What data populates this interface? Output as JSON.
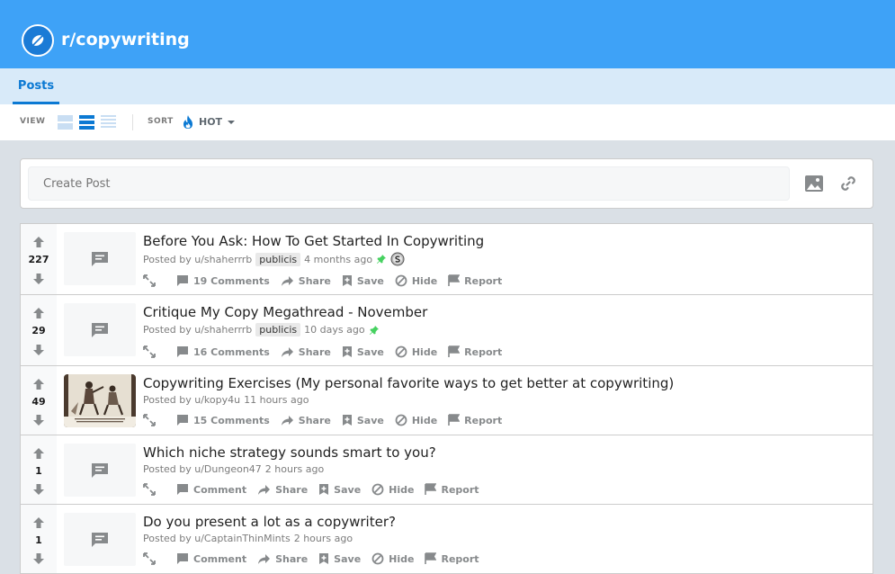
{
  "subreddit": {
    "name": "r/copywriting"
  },
  "tabs": [
    {
      "label": "Posts"
    }
  ],
  "toolbar": {
    "view_label": "VIEW",
    "sort_label": "SORT",
    "sort_value": "HOT"
  },
  "create_post": {
    "placeholder": "Create Post"
  },
  "colors": {
    "banner": "#3ea2f7",
    "tab_bar": "#d8eaf9",
    "accent": "#0b79d3",
    "background": "#dae0e6",
    "pin": "#46d160"
  },
  "posts": [
    {
      "score": "227",
      "title": "Before You Ask: How To Get Started In Copywriting",
      "author": "Posted by u/shaherrrb",
      "flair": "publicis",
      "time": "4 months ago",
      "pinned": true,
      "comments": "19 Comments",
      "thumbnail": "text-post-icon"
    },
    {
      "score": "29",
      "title": "Critique My Copy Megathread - November",
      "author": "Posted by u/shaherrrb",
      "flair": "publicis",
      "time": "10 days ago",
      "pinned": true,
      "comments": "16 Comments",
      "thumbnail": "text-post-icon"
    },
    {
      "score": "49",
      "title": "Copywriting Exercises (My personal favorite ways to get better at copywriting)",
      "author": "Posted by u/kopy4u",
      "time": "11 hours ago",
      "comments": "15 Comments",
      "thumbnail": "image-thumbnail"
    },
    {
      "score": "1",
      "title": "Which niche strategy sounds smart to you?",
      "author": "Posted by u/Dungeon47",
      "time": "2 hours ago",
      "comments": "Comment",
      "thumbnail": "text-post-icon"
    },
    {
      "score": "1",
      "title": "Do you present a lot as a copywriter?",
      "author": "Posted by u/CaptainThinMints",
      "time": "2 hours ago",
      "comments": "Comment",
      "thumbnail": "text-post-icon"
    }
  ],
  "post_actions": {
    "share": "Share",
    "save": "Save",
    "hide": "Hide",
    "report": "Report"
  }
}
